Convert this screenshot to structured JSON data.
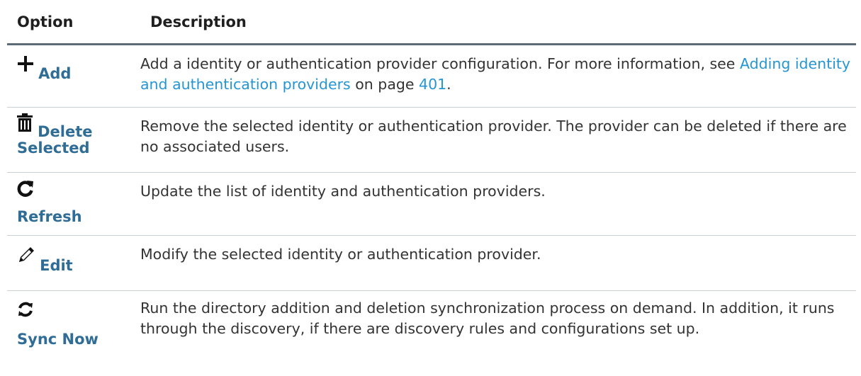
{
  "table": {
    "headers": {
      "option": "Option",
      "description": "Description"
    },
    "rows": [
      {
        "icon": "plus-icon",
        "label": "Add",
        "description_parts": {
          "text1": "Add a identity or authentication provider configuration. For more information, see ",
          "link": "Adding identity and authentication providers",
          "text2": " on page ",
          "page": "401",
          "text3": "."
        }
      },
      {
        "icon": "trash-icon",
        "label_line1": "Delete",
        "label_line2": "Selected",
        "description": "Remove the selected identity or authentication provider. The provider can be deleted if there are no associated users."
      },
      {
        "icon": "refresh-icon",
        "label": "Refresh",
        "description": "Update the list of identity and authentication providers."
      },
      {
        "icon": "pencil-icon",
        "label": "Edit",
        "description": "Modify the selected identity or authentication provider."
      },
      {
        "icon": "sync-icon",
        "label": "Sync Now",
        "description": "Run the directory addition and deletion synchronization process on demand. In addition, it runs through the discovery, if there are discovery rules and configurations set up."
      }
    ]
  },
  "colors": {
    "label": "#2f6d97",
    "link": "#2596d3",
    "header_rule": "#5b6a74",
    "row_rule": "#c9cfd3"
  }
}
